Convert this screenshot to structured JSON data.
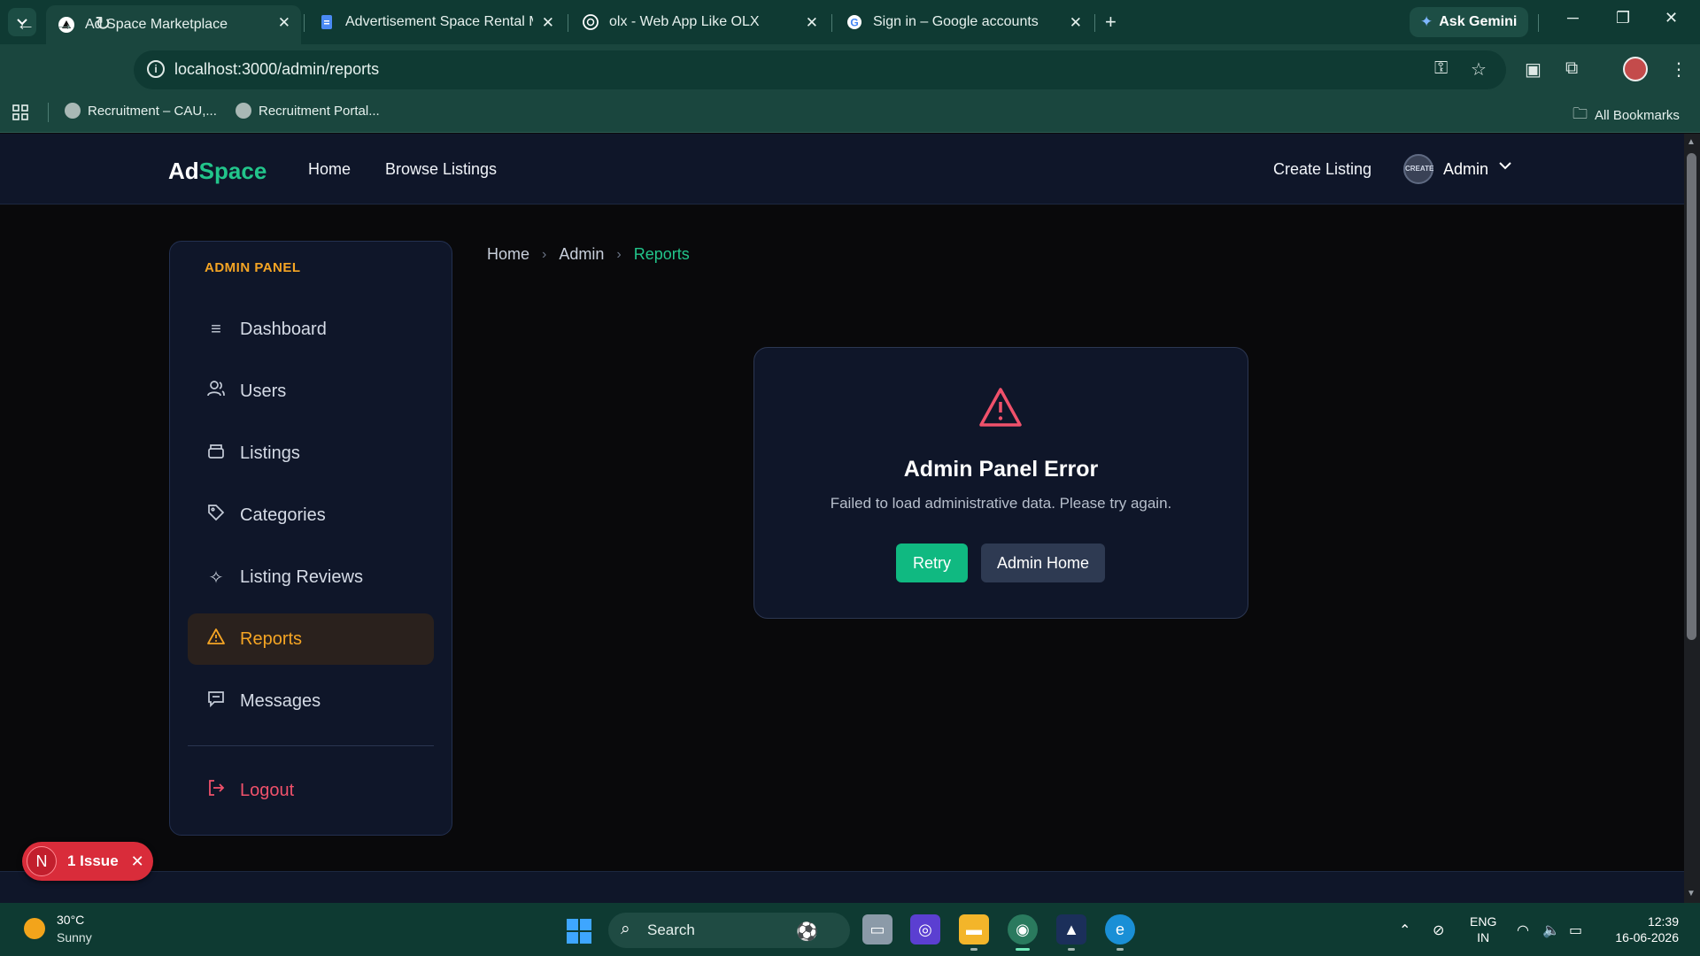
{
  "browser": {
    "tabs": [
      {
        "label": "Ad Space Marketplace",
        "active": true
      },
      {
        "label": "Advertisement Space Rental Ma",
        "active": false
      },
      {
        "label": "olx - Web App Like OLX",
        "active": false
      },
      {
        "label": "Sign in – Google accounts",
        "active": false
      }
    ],
    "ask_gemini": "Ask Gemini",
    "url": "localhost:3000/admin/reports",
    "bookmarks": [
      "Recruitment – CAU,...",
      "Recruitment Portal..."
    ],
    "all_bookmarks": "All Bookmarks"
  },
  "app": {
    "brand_ad": "Ad",
    "brand_space": "Space",
    "nav_links": [
      "Home",
      "Browse Listings"
    ],
    "create_listing": "Create Listing",
    "avatar_text": "CREATE",
    "user_label": "Admin"
  },
  "sidebar": {
    "title": "ADMIN PANEL",
    "items": [
      {
        "label": "Dashboard",
        "icon": "list-icon"
      },
      {
        "label": "Users",
        "icon": "users-icon"
      },
      {
        "label": "Listings",
        "icon": "box-icon"
      },
      {
        "label": "Categories",
        "icon": "tag-icon"
      },
      {
        "label": "Listing Reviews",
        "icon": "sparkle-icon"
      },
      {
        "label": "Reports",
        "icon": "warning-icon",
        "active": true
      },
      {
        "label": "Messages",
        "icon": "message-icon"
      }
    ],
    "logout": "Logout"
  },
  "breadcrumb": [
    "Home",
    "Admin",
    "Reports"
  ],
  "error": {
    "title": "Admin Panel Error",
    "message": "Failed to load administrative data. Please try again.",
    "retry": "Retry",
    "admin_home": "Admin Home"
  },
  "issue_badge": {
    "letter": "N",
    "text": "1 Issue"
  },
  "taskbar": {
    "temperature": "30°C",
    "condition": "Sunny",
    "search": "Search",
    "lang_top": "ENG",
    "lang_bottom": "IN",
    "time": "12:39",
    "date": "16-06-2026"
  },
  "colors": {
    "accent_green": "#22c58b",
    "accent_orange": "#f5a524",
    "danger_red": "#f0516b",
    "panel_bg": "#0f1629"
  }
}
